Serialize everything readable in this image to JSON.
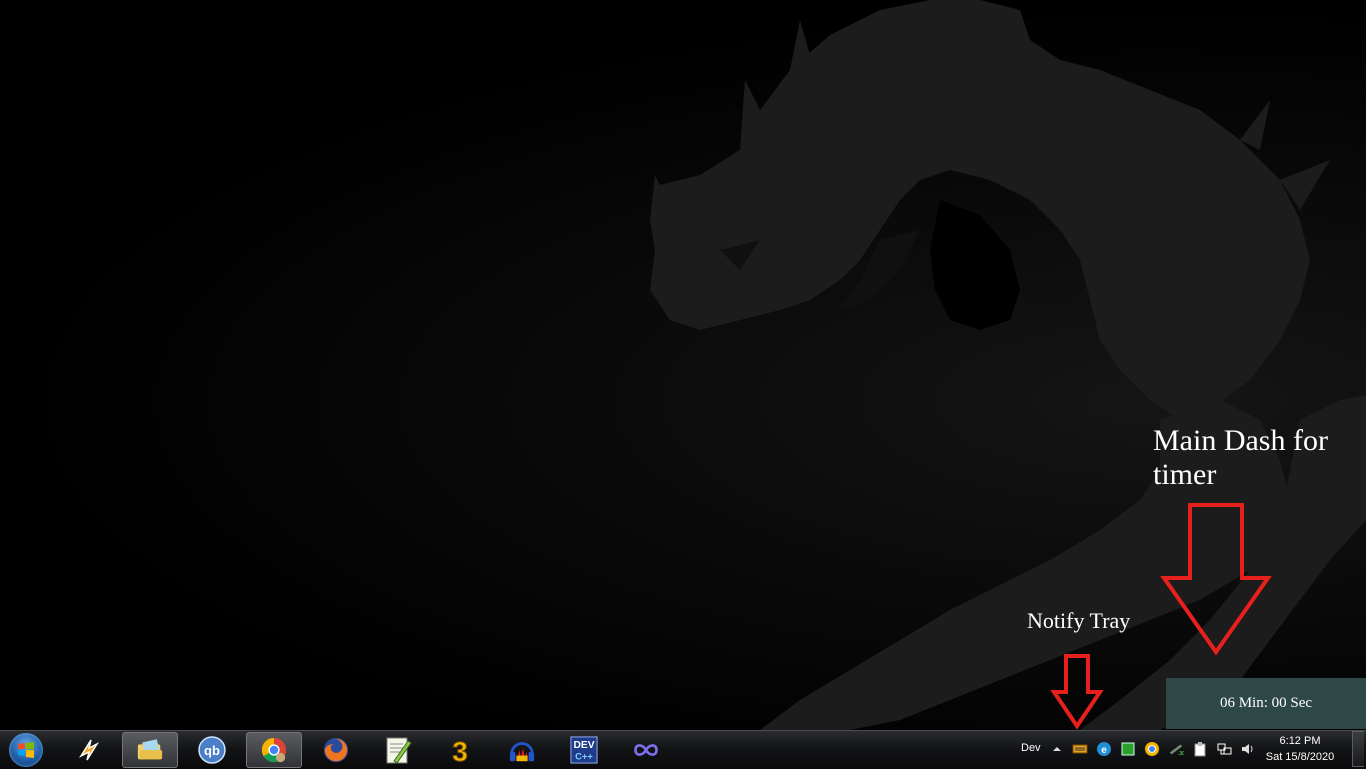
{
  "annotations": {
    "main_dash": "Main Dash for timer",
    "notify_tray": "Notify Tray"
  },
  "timer": {
    "display": "06 Min: 00 Sec"
  },
  "taskbar": {
    "pinned": [
      {
        "name": "winamp",
        "icon": "lightning-bolt-icon"
      },
      {
        "name": "windows-explorer",
        "icon": "folder-icon",
        "active": true
      },
      {
        "name": "qbittorrent",
        "icon": "qb-icon"
      },
      {
        "name": "google-chrome",
        "icon": "chrome-icon",
        "active": true
      },
      {
        "name": "firefox",
        "icon": "firefox-icon"
      },
      {
        "name": "notepad-plus-plus",
        "icon": "notepad-icon"
      },
      {
        "name": "app-3",
        "icon": "number-three-icon",
        "label": "3"
      },
      {
        "name": "audio-app",
        "icon": "headphones-icon"
      },
      {
        "name": "dev-cpp",
        "icon": "dev-cpp-icon",
        "label": "DEV"
      },
      {
        "name": "infinity-app",
        "icon": "infinity-icon"
      }
    ]
  },
  "tray": {
    "language": "Dev",
    "icons": [
      "show-hidden-icons-chevron",
      "keyboard-icon",
      "e-app-icon",
      "green-square-icon",
      "chrome-tray-icon",
      "network-speed-icon",
      "clipboard-icon",
      "network-icon",
      "volume-icon"
    ]
  },
  "clock": {
    "time": "6:12 PM",
    "date": "Sat 15/8/2020"
  },
  "colors": {
    "timer_bg": "#2e4848",
    "arrow_red": "#e8201c",
    "taskbar_bg": "#131416"
  }
}
